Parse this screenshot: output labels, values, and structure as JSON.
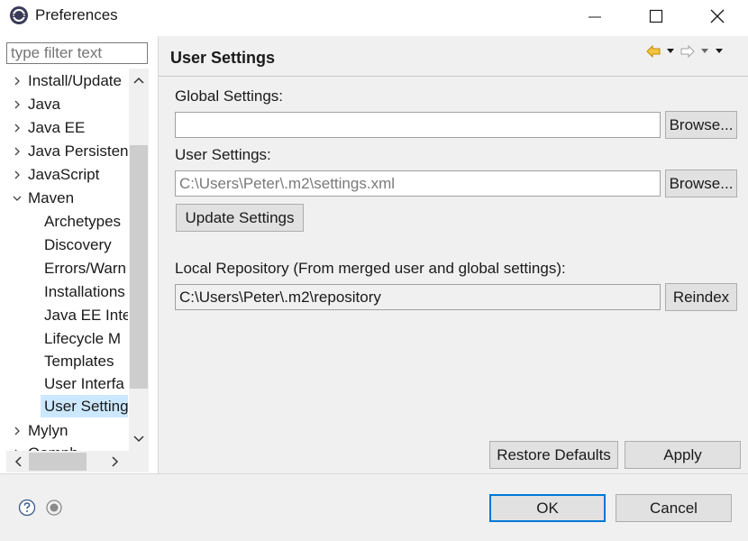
{
  "window": {
    "title": "Preferences"
  },
  "filter": {
    "placeholder": "type filter text"
  },
  "tree": {
    "items": [
      {
        "label": "Install/Update",
        "level": 0,
        "expanded": false
      },
      {
        "label": "Java",
        "level": 0,
        "expanded": false
      },
      {
        "label": "Java EE",
        "level": 0,
        "expanded": false
      },
      {
        "label": "Java Persisten",
        "level": 0,
        "expanded": false
      },
      {
        "label": "JavaScript",
        "level": 0,
        "expanded": false
      },
      {
        "label": "Maven",
        "level": 0,
        "expanded": true
      },
      {
        "label": "Archetypes",
        "level": 1
      },
      {
        "label": "Discovery",
        "level": 1
      },
      {
        "label": "Errors/Warn",
        "level": 1
      },
      {
        "label": "Installations",
        "level": 1
      },
      {
        "label": "Java EE Inte",
        "level": 1
      },
      {
        "label": "Lifecycle M",
        "level": 1
      },
      {
        "label": "Templates",
        "level": 1
      },
      {
        "label": "User Interfa",
        "level": 1
      },
      {
        "label": "User Setting",
        "level": 1,
        "selected": true
      },
      {
        "label": "Mylyn",
        "level": 0,
        "expanded": false
      },
      {
        "label": "Oomph",
        "level": 0,
        "expanded": false
      }
    ]
  },
  "page": {
    "title": "User Settings",
    "global_settings_label": "Global Settings:",
    "global_settings_value": "",
    "user_settings_label": "User Settings:",
    "user_settings_placeholder": "C:\\Users\\Peter\\.m2\\settings.xml",
    "update_settings_button": "Update Settings",
    "local_repo_label": "Local Repository (From merged user and global settings):",
    "local_repo_value": "C:\\Users\\Peter\\.m2\\repository",
    "browse_label": "Browse...",
    "reindex_label": "Reindex",
    "restore_defaults_label": "Restore Defaults",
    "apply_label": "Apply"
  },
  "dialog": {
    "ok_label": "OK",
    "cancel_label": "Cancel"
  },
  "colors": {
    "accent": "#0078d7",
    "selection": "#cce8ff",
    "panel": "#f0f0f0",
    "nav_arrow": "#e8a000"
  }
}
